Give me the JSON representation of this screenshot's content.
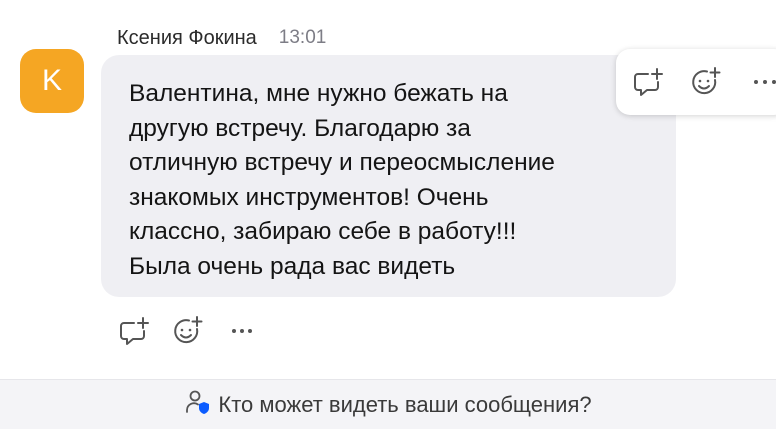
{
  "message": {
    "sender": "Ксения Фокина",
    "time": "13:01",
    "avatar_letter": "K",
    "avatar_color": "#f5a623",
    "text": "Валентина, мне нужно бежать на\nдругую встречу. Благодарю за\nотличную встречу и переосмысление\nзнакомых инструментов! Очень\nклассно, забираю себе в работу!!!\nБыла очень рада вас видеть"
  },
  "actions": {
    "reply_icon": "comment-add-icon",
    "reaction_icon": "emoji-add-icon",
    "more_icon": "more-horizontal-icon"
  },
  "footer": {
    "text": "Кто может видеть ваши сообщения?",
    "icon": "user-shield-icon",
    "accent": "#0b5cff"
  }
}
